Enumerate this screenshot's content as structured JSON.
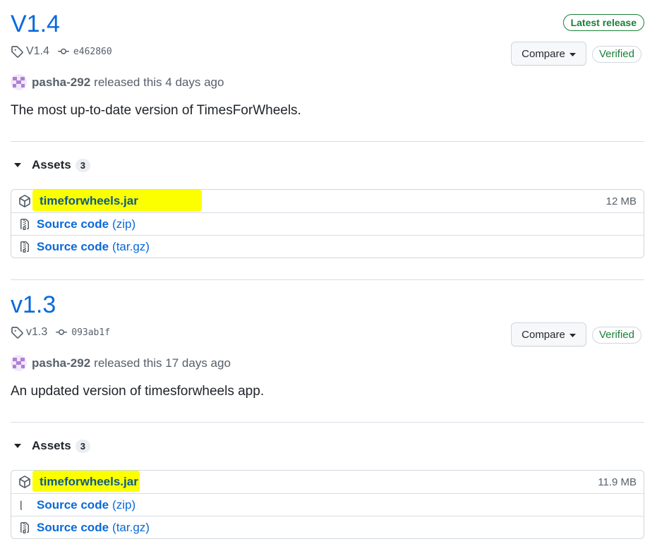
{
  "releases": [
    {
      "title": "V1.4",
      "latest_badge": "Latest release",
      "tag": "V1.4",
      "commit": "e462860",
      "compare_label": "Compare",
      "verified_label": "Verified",
      "author": "pasha-292",
      "released_text": "released this 4 days ago",
      "description": "The most up-to-date version of TimesForWheels.",
      "assets_label": "Assets",
      "assets_count": "3",
      "assets": [
        {
          "name": "timeforwheels.jar",
          "size": "12 MB"
        },
        {
          "label": "Source code",
          "ext": "(zip)"
        },
        {
          "label": "Source code",
          "ext": "(tar.gz)"
        }
      ]
    },
    {
      "title": "v1.3",
      "tag": "v1.3",
      "commit": "093ab1f",
      "compare_label": "Compare",
      "verified_label": "Verified",
      "author": "pasha-292",
      "released_text": "released this 17 days ago",
      "description": "An updated version of timesforwheels app.",
      "assets_label": "Assets",
      "assets_count": "3",
      "assets": [
        {
          "name": "timeforwheels.jar",
          "size": "11.9 MB"
        },
        {
          "label": "Source code",
          "ext": "(zip)"
        },
        {
          "label": "Source code",
          "ext": "(tar.gz)"
        }
      ]
    }
  ],
  "colors": {
    "link": "#0969da",
    "verified": "#1a7f37",
    "highlight": "#fbff00"
  },
  "icons": [
    "tag-icon",
    "commit-icon",
    "package-icon",
    "file-zip-icon",
    "triangle-down-icon"
  ]
}
